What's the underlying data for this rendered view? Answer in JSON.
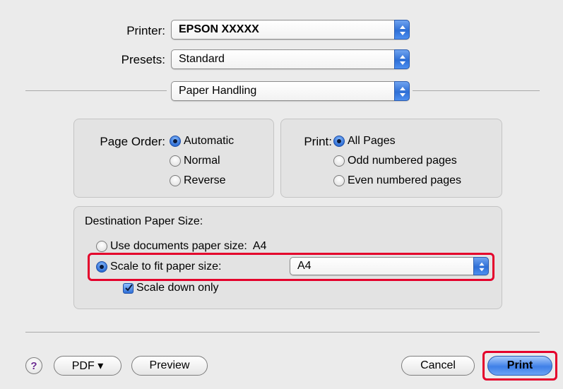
{
  "header": {
    "printer_label": "Printer:",
    "printer_value": "EPSON XXXXX",
    "presets_label": "Presets:",
    "presets_value": "Standard",
    "section_value": "Paper Handling"
  },
  "page_order": {
    "label": "Page Order:",
    "options": [
      "Automatic",
      "Normal",
      "Reverse"
    ],
    "selected": "Automatic"
  },
  "print_range": {
    "label": "Print:",
    "options": [
      "All Pages",
      "Odd numbered pages",
      "Even numbered pages"
    ],
    "selected": "All Pages"
  },
  "destination": {
    "title": "Destination Paper Size:",
    "use_documents_label": "Use documents paper size:",
    "use_documents_value": "A4",
    "scale_to_fit_label": "Scale to fit paper size:",
    "scale_to_fit_value": "A4",
    "scale_down_only_label": "Scale down only",
    "scale_down_only_checked": true
  },
  "footer": {
    "help_label": "?",
    "pdf_label": "PDF ▾",
    "preview_label": "Preview",
    "cancel_label": "Cancel",
    "print_label": "Print"
  },
  "colors": {
    "highlight": "#e4002b",
    "accent_blue": "#2f6fd6"
  }
}
